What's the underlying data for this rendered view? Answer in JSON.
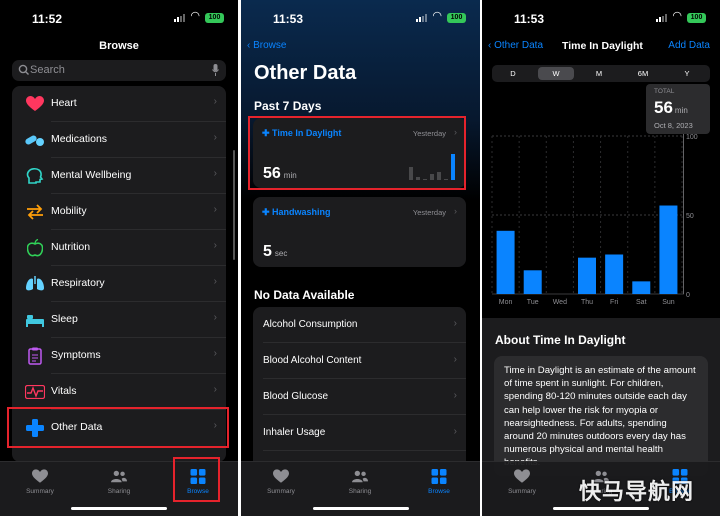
{
  "status": {
    "time_1": "11:52",
    "time_2": "11:53",
    "time_3": "11:53",
    "battery": "100"
  },
  "browse": {
    "title": "Browse",
    "search_placeholder": "Search",
    "items": [
      {
        "label": "Heart",
        "icon": "heart-icon"
      },
      {
        "label": "Medications",
        "icon": "pill-icon"
      },
      {
        "label": "Mental Wellbeing",
        "icon": "head-icon"
      },
      {
        "label": "Mobility",
        "icon": "arrows-icon"
      },
      {
        "label": "Nutrition",
        "icon": "apple-icon"
      },
      {
        "label": "Respiratory",
        "icon": "lungs-icon"
      },
      {
        "label": "Sleep",
        "icon": "bed-icon"
      },
      {
        "label": "Symptoms",
        "icon": "clipboard-icon"
      },
      {
        "label": "Vitals",
        "icon": "waveform-icon"
      },
      {
        "label": "Other Data",
        "icon": "plus-icon"
      }
    ]
  },
  "tabbar": {
    "summary": "Summary",
    "sharing": "Sharing",
    "browse": "Browse"
  },
  "other_data": {
    "back": "Browse",
    "title": "Other Data",
    "past_section": "Past 7 Days",
    "cards": [
      {
        "title": "Time In Daylight",
        "date": "Yesterday",
        "value": "56",
        "unit": "min"
      },
      {
        "title": "Handwashing",
        "date": "Yesterday",
        "value": "5",
        "unit": "sec"
      }
    ],
    "no_data_section": "No Data Available",
    "no_data_items": [
      "Alcohol Consumption",
      "Blood Alcohol Content",
      "Blood Glucose",
      "Inhaler Usage"
    ]
  },
  "detail": {
    "back": "Other Data",
    "title": "Time In Daylight",
    "add": "Add Data",
    "segments": [
      "D",
      "W",
      "M",
      "6M",
      "Y"
    ],
    "selected_segment": "W",
    "tooltip": {
      "label": "TOTAL",
      "value": "56",
      "unit": "min",
      "date": "Oct 8, 2023"
    },
    "about_title": "About Time In Daylight",
    "about_text": "Time in Daylight is an estimate of the amount of time spent in sunlight. For children, spending 80-120 minutes outside each day can help lower the risk for myopia or nearsightedness. For adults, spending around 20 minutes outdoors every day has numerous physical and mental health benefits."
  },
  "chart_data": {
    "type": "bar",
    "categories": [
      "Mon",
      "Tue",
      "Wed",
      "Thu",
      "Fri",
      "Sat",
      "Sun"
    ],
    "values": [
      40,
      15,
      0,
      23,
      25,
      8,
      56
    ],
    "yticks": [
      "100",
      "50",
      "0"
    ],
    "ylim": [
      0,
      100
    ],
    "accent": "#0a84ff"
  },
  "mini_chart": {
    "values": [
      30,
      6,
      0,
      15,
      18,
      2,
      60
    ]
  },
  "watermark": "快马导航网"
}
